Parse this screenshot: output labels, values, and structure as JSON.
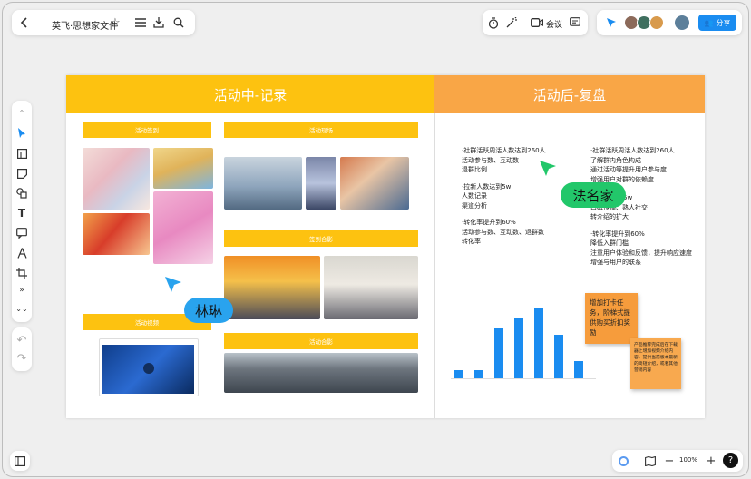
{
  "window": {
    "title": "英飞·思想家文件"
  },
  "top_right": {
    "meeting_label": "会议",
    "share_label": "分享"
  },
  "zoom": {
    "level": "100%"
  },
  "board": {
    "left_header": "活动中-记录",
    "right_header": "活动后-复盘",
    "pills": {
      "signin": "活动签到",
      "site": "活动现场",
      "group1": "签到合影",
      "video": "活动视频",
      "group2": "活动合影"
    },
    "col1": {
      "g1": [
        "·社群活跃周活人数达到260人",
        "活动参与数、互动数",
        "退群比例"
      ],
      "g2": [
        "·拉新人数达到5w",
        "人数记录",
        "渠道分析"
      ],
      "g3": [
        "·转化率提升到60%",
        "活动参与数、互动数、退群数",
        "转化率"
      ]
    },
    "col2": {
      "g1": [
        "·社群活跃周活人数达到260人",
        "了解群内角色构成",
        "通过活动等提升用户参与度",
        "增强用户对群的依赖度"
      ],
      "g2": [
        "5w",
        "口碑传播、熟人社交",
        "转介绍的扩大"
      ],
      "g3": [
        "·转化率提升到60%",
        "降低入群门槛",
        "注重用户体验和反馈，提升响应速度",
        "增强与用户的联系"
      ]
    },
    "cursors": {
      "user1": "林琳",
      "user2": "法名家"
    },
    "sticky1": "增加打卡任务，阶梯式提供购买折扣奖励",
    "sticky2": "产品推荐完成后在下载器上增加视频介绍内容，提供当前版本最新的简短介绍，或者其他营销内容"
  },
  "chart_data": {
    "type": "bar",
    "categories": [
      "",
      "",
      "",
      "",
      "",
      "",
      ""
    ],
    "values": [
      10,
      10,
      62,
      75,
      88,
      55,
      22
    ],
    "ylim": [
      0,
      100
    ],
    "color": "#1a8cf0"
  },
  "colors": {
    "yellow": "#fdc210",
    "orange": "#f9a646",
    "blue": "#1a8cf0",
    "green": "#22c76a",
    "cursor_blue": "#29a3ee"
  }
}
